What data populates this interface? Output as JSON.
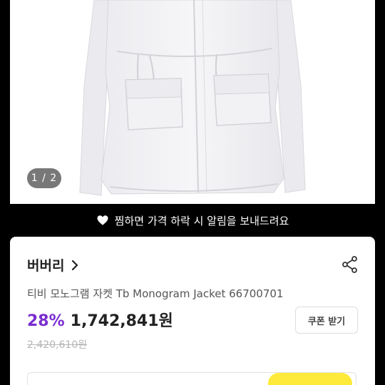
{
  "product_image": {
    "page_indicator": "1 / 2"
  },
  "wish_banner": {
    "icon": "heart-icon",
    "text": "찜하면 가격 하락 시 알림을 보내드려요"
  },
  "product": {
    "brand": "버버리",
    "brand_icon": "chevron-right-icon",
    "share_icon": "share-icon",
    "title": "티비 모노그램 자켓 Tb Monogram Jacket 66700701",
    "discount": "28%",
    "price": "1,742,841원",
    "original_price": "2,420,610원",
    "coupon_label": "쿠폰 받기"
  },
  "colors": {
    "discount": "#7a2dd0",
    "accent_yellow": "#fdea3a"
  }
}
